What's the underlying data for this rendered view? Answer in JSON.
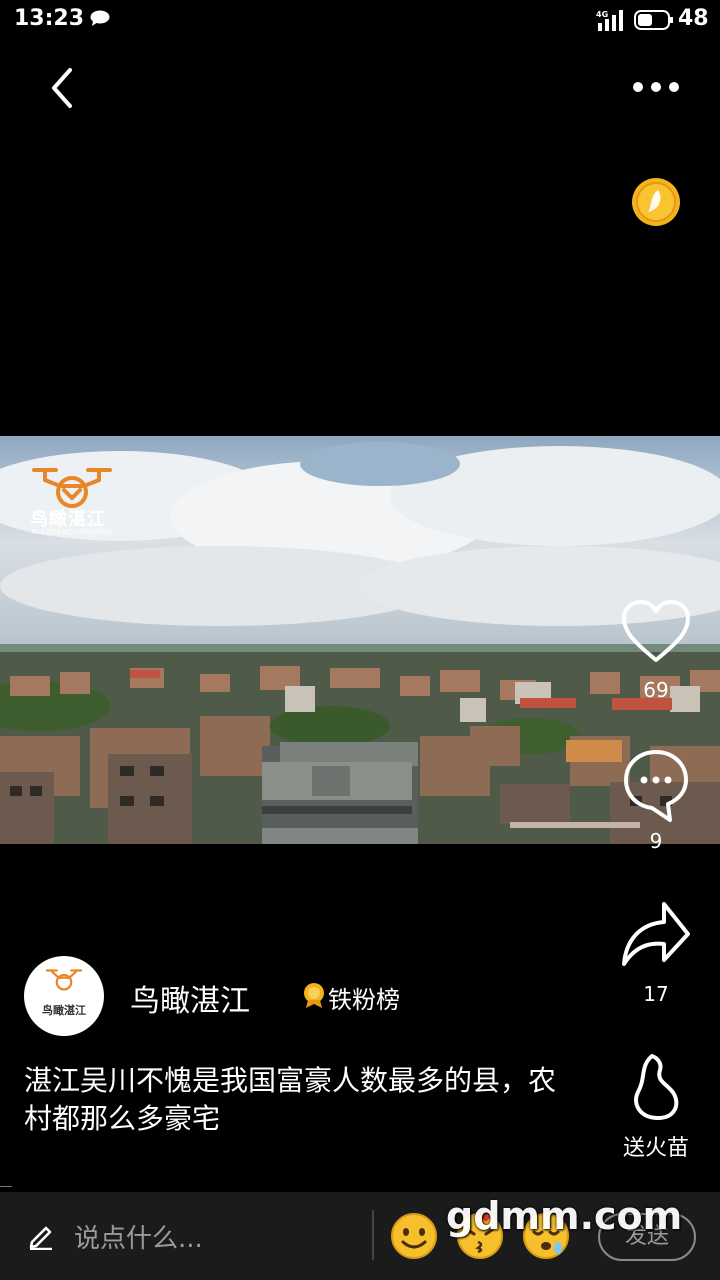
{
  "status_bar": {
    "time": "13:23",
    "network": "4G",
    "battery": "48"
  },
  "top_bar": {
    "back_icon": "chevron-left-icon",
    "more_icon": "more-dots-icon",
    "coin_icon": "gold-coin-icon"
  },
  "video": {
    "watermark": {
      "brand_cn": "鸟瞰湛江",
      "brand_en": "NIAOKANZHANJIANG"
    }
  },
  "actions": {
    "like_count": "69",
    "comment_count": "9",
    "share_count": "17",
    "flame_label": "送火苗"
  },
  "author": {
    "name": "鸟瞰湛江",
    "badge": "铁粉榜",
    "avatar_text": "鸟瞰湛江"
  },
  "caption": "湛江吴川不愧是我国富豪人数最多的县，农村都那么多豪宅",
  "bottom_bar": {
    "input_placeholder": "说点什么...",
    "send_label": "发送",
    "site_watermark": "gdmm.com"
  },
  "colors": {
    "brand_orange": "#e8862a",
    "coin_gold": "#f4b21c"
  }
}
